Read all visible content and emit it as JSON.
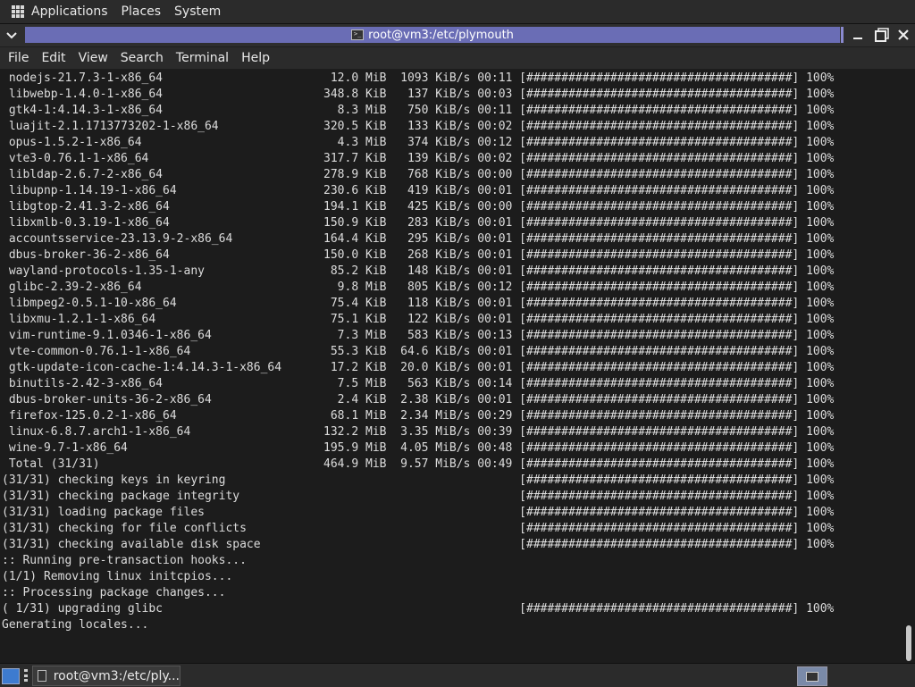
{
  "top_panel": {
    "menus": [
      "Applications",
      "Places",
      "System"
    ]
  },
  "window": {
    "title": "root@vm3:/etc/plymouth",
    "controls": {
      "minimize": "—",
      "maximize": "□",
      "close": "✕"
    }
  },
  "menubar": {
    "items": [
      "File",
      "Edit",
      "View",
      "Search",
      "Terminal",
      "Help"
    ]
  },
  "terminal": {
    "lines": [
      " nodejs-21.7.3-1-x86_64                        12.0 MiB  1093 KiB/s 00:11 [######################################] 100%",
      " libwebp-1.4.0-1-x86_64                       348.8 KiB   137 KiB/s 00:03 [######################################] 100%",
      " gtk4-1:4.14.3-1-x86_64                         8.3 MiB   750 KiB/s 00:11 [######################################] 100%",
      " luajit-2.1.1713773202-1-x86_64               320.5 KiB   133 KiB/s 00:02 [######################################] 100%",
      " opus-1.5.2-1-x86_64                            4.3 MiB   374 KiB/s 00:12 [######################################] 100%",
      " vte3-0.76.1-1-x86_64                         317.7 KiB   139 KiB/s 00:02 [######################################] 100%",
      " libldap-2.6.7-2-x86_64                       278.9 KiB   768 KiB/s 00:00 [######################################] 100%",
      " libupnp-1.14.19-1-x86_64                     230.6 KiB   419 KiB/s 00:01 [######################################] 100%",
      " libgtop-2.41.3-2-x86_64                      194.1 KiB   425 KiB/s 00:00 [######################################] 100%",
      " libxmlb-0.3.19-1-x86_64                      150.9 KiB   283 KiB/s 00:01 [######################################] 100%",
      " accountsservice-23.13.9-2-x86_64             164.4 KiB   295 KiB/s 00:01 [######################################] 100%",
      " dbus-broker-36-2-x86_64                      150.0 KiB   268 KiB/s 00:01 [######################################] 100%",
      " wayland-protocols-1.35-1-any                  85.2 KiB   148 KiB/s 00:01 [######################################] 100%",
      " glibc-2.39-2-x86_64                            9.8 MiB   805 KiB/s 00:12 [######################################] 100%",
      " libmpeg2-0.5.1-10-x86_64                      75.4 KiB   118 KiB/s 00:01 [######################################] 100%",
      " libxmu-1.2.1-1-x86_64                         75.1 KiB   122 KiB/s 00:01 [######################################] 100%",
      " vim-runtime-9.1.0346-1-x86_64                  7.3 MiB   583 KiB/s 00:13 [######################################] 100%",
      " vte-common-0.76.1-1-x86_64                    55.3 KiB  64.6 KiB/s 00:01 [######################################] 100%",
      " gtk-update-icon-cache-1:4.14.3-1-x86_64       17.2 KiB  20.0 KiB/s 00:01 [######################################] 100%",
      " binutils-2.42-3-x86_64                         7.5 MiB   563 KiB/s 00:14 [######################################] 100%",
      " dbus-broker-units-36-2-x86_64                  2.4 KiB  2.38 KiB/s 00:01 [######################################] 100%",
      " firefox-125.0.2-1-x86_64                      68.1 MiB  2.34 MiB/s 00:29 [######################################] 100%",
      " linux-6.8.7.arch1-1-x86_64                   132.2 MiB  3.35 MiB/s 00:39 [######################################] 100%",
      " wine-9.7-1-x86_64                            195.9 MiB  4.05 MiB/s 00:48 [######################################] 100%",
      " Total (31/31)                                464.9 MiB  9.57 MiB/s 00:49 [######################################] 100%",
      "(31/31) checking keys in keyring                                          [######################################] 100%",
      "(31/31) checking package integrity                                        [######################################] 100%",
      "(31/31) loading package files                                             [######################################] 100%",
      "(31/31) checking for file conflicts                                       [######################################] 100%",
      "(31/31) checking available disk space                                     [######################################] 100%",
      ":: Running pre-transaction hooks...",
      "(1/1) Removing linux initcpios...",
      ":: Processing package changes...",
      "( 1/31) upgrading glibc                                                   [######################################] 100%",
      "Generating locales..."
    ]
  },
  "taskbar": {
    "task_label": "root@vm3:/etc/ply..."
  },
  "colors": {
    "title_strip": "#6a6db5",
    "terminal_bg": "#1c1c1c",
    "panel_bg": "#2b2b2b"
  }
}
